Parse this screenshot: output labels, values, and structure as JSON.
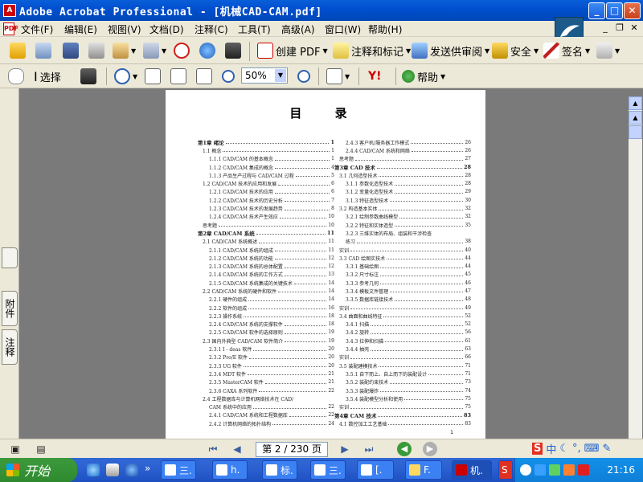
{
  "window": {
    "app_icon": "acrobat-icon",
    "title": "Adobe Acrobat Professional - [机械CAD-CAM.pdf]",
    "minimize": "_",
    "maximize": "□",
    "close": "✕"
  },
  "menu": {
    "items": [
      "文件(F)",
      "编辑(E)",
      "视图(V)",
      "文档(D)",
      "注释(C)",
      "工具(T)",
      "高级(A)",
      "窗口(W)",
      "帮助(H)"
    ],
    "mdi_min": "_",
    "mdi_restore": "❐",
    "mdi_close": "✕"
  },
  "toolbar1": {
    "create_pdf": "创建 PDF",
    "comment_markup": "注释和标记",
    "send_review": "发送供审阅",
    "security": "安全",
    "sign": "签名"
  },
  "toolbar2": {
    "select": "选择",
    "zoom_value": "50%",
    "help": "帮助"
  },
  "side_tabs": [
    "附件",
    "注释"
  ],
  "document": {
    "title": "目 录",
    "footer_page": "1",
    "left_column": [
      {
        "t": "第1章  绪论",
        "p": "1",
        "lvl": 0
      },
      {
        "t": "1.1  概念",
        "p": "1",
        "lvl": 1
      },
      {
        "t": "1.1.1  CAD/CAM 的基本概念",
        "p": "1",
        "lvl": 2
      },
      {
        "t": "1.1.2  CAD/CAM 集成的概念",
        "p": "4",
        "lvl": 2
      },
      {
        "t": "1.1.3  产品生产过程与 CAD/CAM 过程",
        "p": "5",
        "lvl": 2
      },
      {
        "t": "1.2  CAD/CAM 技术的应用和发展",
        "p": "6",
        "lvl": 1
      },
      {
        "t": "1.2.1  CAD/CAM 技术的应用",
        "p": "6",
        "lvl": 2
      },
      {
        "t": "1.2.2  CAD/CAM 技术的历史分析",
        "p": "7",
        "lvl": 2
      },
      {
        "t": "1.2.3  CAD/CAM 技术的发展趋势",
        "p": "8",
        "lvl": 2
      },
      {
        "t": "1.2.4  CAD/CAM 技术产生效应",
        "p": "10",
        "lvl": 2
      },
      {
        "t": "思考题",
        "p": "10",
        "lvl": 1
      },
      {
        "t": "第2章  CAD/CAM 系统",
        "p": "11",
        "lvl": 0
      },
      {
        "t": "2.1  CAD/CAM 系统概述",
        "p": "11",
        "lvl": 1
      },
      {
        "t": "2.1.1  CAD/CAM 系统的组成",
        "p": "11",
        "lvl": 2
      },
      {
        "t": "2.1.2  CAD/CAM 系统的功能",
        "p": "12",
        "lvl": 2
      },
      {
        "t": "2.1.3  CAD/CAM 系统的总体配置",
        "p": "12",
        "lvl": 2
      },
      {
        "t": "2.1.4  CAD/CAM 系统的工作方式",
        "p": "13",
        "lvl": 2
      },
      {
        "t": "2.1.5  CAD/CAM 系统集成的关键技术",
        "p": "14",
        "lvl": 2
      },
      {
        "t": "2.2  CAD/CAM 系统的硬件和软件",
        "p": "14",
        "lvl": 1
      },
      {
        "t": "2.2.1  硬件的组成",
        "p": "14",
        "lvl": 2
      },
      {
        "t": "2.2.2  软件的组成",
        "p": "16",
        "lvl": 2
      },
      {
        "t": "2.2.3  操作系统",
        "p": "18",
        "lvl": 2
      },
      {
        "t": "2.2.4  CAD/CAM 系统的支撑软件",
        "p": "18",
        "lvl": 2
      },
      {
        "t": "2.2.5  CAD/CAM 软件的选择原则",
        "p": "19",
        "lvl": 2
      },
      {
        "t": "2.3  国内外典型 CAD/CAM 软件简介",
        "p": "19",
        "lvl": 1
      },
      {
        "t": "2.3.1  I - deas 软件",
        "p": "20",
        "lvl": 2
      },
      {
        "t": "2.3.2  Pro/E 软件",
        "p": "20",
        "lvl": 2
      },
      {
        "t": "2.3.3  UG 软件",
        "p": "20",
        "lvl": 2
      },
      {
        "t": "2.3.4  MDT 软件",
        "p": "21",
        "lvl": 2
      },
      {
        "t": "2.3.5  MasterCAM 软件",
        "p": "21",
        "lvl": 2
      },
      {
        "t": "2.3.6  CAXA 系列软件",
        "p": "22",
        "lvl": 2
      },
      {
        "t": "2.4  工程数据库与计算机网络技术在 CAD/",
        "p": "",
        "lvl": 1
      },
      {
        "t": "CAM 系统中的应用",
        "p": "22",
        "lvl": 2
      },
      {
        "t": "2.4.1  CAD/CAM 系统和工程数据库",
        "p": "22",
        "lvl": 2
      },
      {
        "t": "2.4.2  计算机网络的拓扑结构",
        "p": "24",
        "lvl": 2
      }
    ],
    "right_column": [
      {
        "t": "2.4.3  客户机/服务器工作模式",
        "p": "26",
        "lvl": 2
      },
      {
        "t": "2.4.4  CAD/CAM 系统和网络",
        "p": "26",
        "lvl": 2
      },
      {
        "t": "思考题",
        "p": "27",
        "lvl": 1
      },
      {
        "t": "第3章  CAD 技术",
        "p": "28",
        "lvl": 0
      },
      {
        "t": "3.1  几何造型技术",
        "p": "28",
        "lvl": 1
      },
      {
        "t": "3.1.1  参数化造型技术",
        "p": "28",
        "lvl": 2
      },
      {
        "t": "3.1.2  变量化造型技术",
        "p": "29",
        "lvl": 2
      },
      {
        "t": "3.1.3  特征造型技术",
        "p": "30",
        "lvl": 2
      },
      {
        "t": "3.2  构造基本实体",
        "p": "32",
        "lvl": 1
      },
      {
        "t": "3.2.1  绘制参数曲线模型",
        "p": "32",
        "lvl": 2
      },
      {
        "t": "3.2.2  特征和实体造型",
        "p": "35",
        "lvl": 2
      },
      {
        "t": "3.2.3  三维实体的布局、组装和干涉检查",
        "p": "",
        "lvl": 2
      },
      {
        "t": "练习",
        "p": "38",
        "lvl": 2
      },
      {
        "t": "实训",
        "p": "40",
        "lvl": 1
      },
      {
        "t": "3.3  CAD 绘图实技术",
        "p": "44",
        "lvl": 1
      },
      {
        "t": "3.3.1  基础绘图",
        "p": "44",
        "lvl": 2
      },
      {
        "t": "3.3.2  尺寸标注",
        "p": "45",
        "lvl": 2
      },
      {
        "t": "3.3.3  参考几何",
        "p": "46",
        "lvl": 2
      },
      {
        "t": "3.3.4  模板文件管理",
        "p": "47",
        "lvl": 2
      },
      {
        "t": "3.3.5  数据库链接技术",
        "p": "48",
        "lvl": 2
      },
      {
        "t": "实训",
        "p": "49",
        "lvl": 1
      },
      {
        "t": "3.4  曲面和曲线特征",
        "p": "52",
        "lvl": 1
      },
      {
        "t": "3.4.1  扫描",
        "p": "52",
        "lvl": 2
      },
      {
        "t": "3.4.2  旋转",
        "p": "56",
        "lvl": 2
      },
      {
        "t": "3.4.3  拉伸和扫描",
        "p": "61",
        "lvl": 2
      },
      {
        "t": "3.4.4  抽壳",
        "p": "63",
        "lvl": 2
      },
      {
        "t": "实训",
        "p": "66",
        "lvl": 1
      },
      {
        "t": "3.5  装配建模技术",
        "p": "71",
        "lvl": 1
      },
      {
        "t": "3.5.1  自下而上、自上而下的装配设计",
        "p": "71",
        "lvl": 2
      },
      {
        "t": "3.5.2  装配约束技术",
        "p": "73",
        "lvl": 2
      },
      {
        "t": "3.5.3  装配爆炸",
        "p": "74",
        "lvl": 2
      },
      {
        "t": "3.5.4  装配模型分析和使用",
        "p": "75",
        "lvl": 2
      },
      {
        "t": "实训",
        "p": "75",
        "lvl": 1
      },
      {
        "t": "第4章  CAM 技术",
        "p": "83",
        "lvl": 0
      },
      {
        "t": "4.1  数控加工工艺基础",
        "p": "83",
        "lvl": 1
      }
    ]
  },
  "navigation": {
    "page_indicator": "第 2 / 230 页"
  },
  "taskbar": {
    "start": "开始",
    "tasks": [
      "三.",
      "h.",
      "标.",
      "三.",
      "[.",
      "F.",
      "机.",
      "S"
    ],
    "clock": "21:16"
  },
  "ime": {
    "label": "中"
  }
}
